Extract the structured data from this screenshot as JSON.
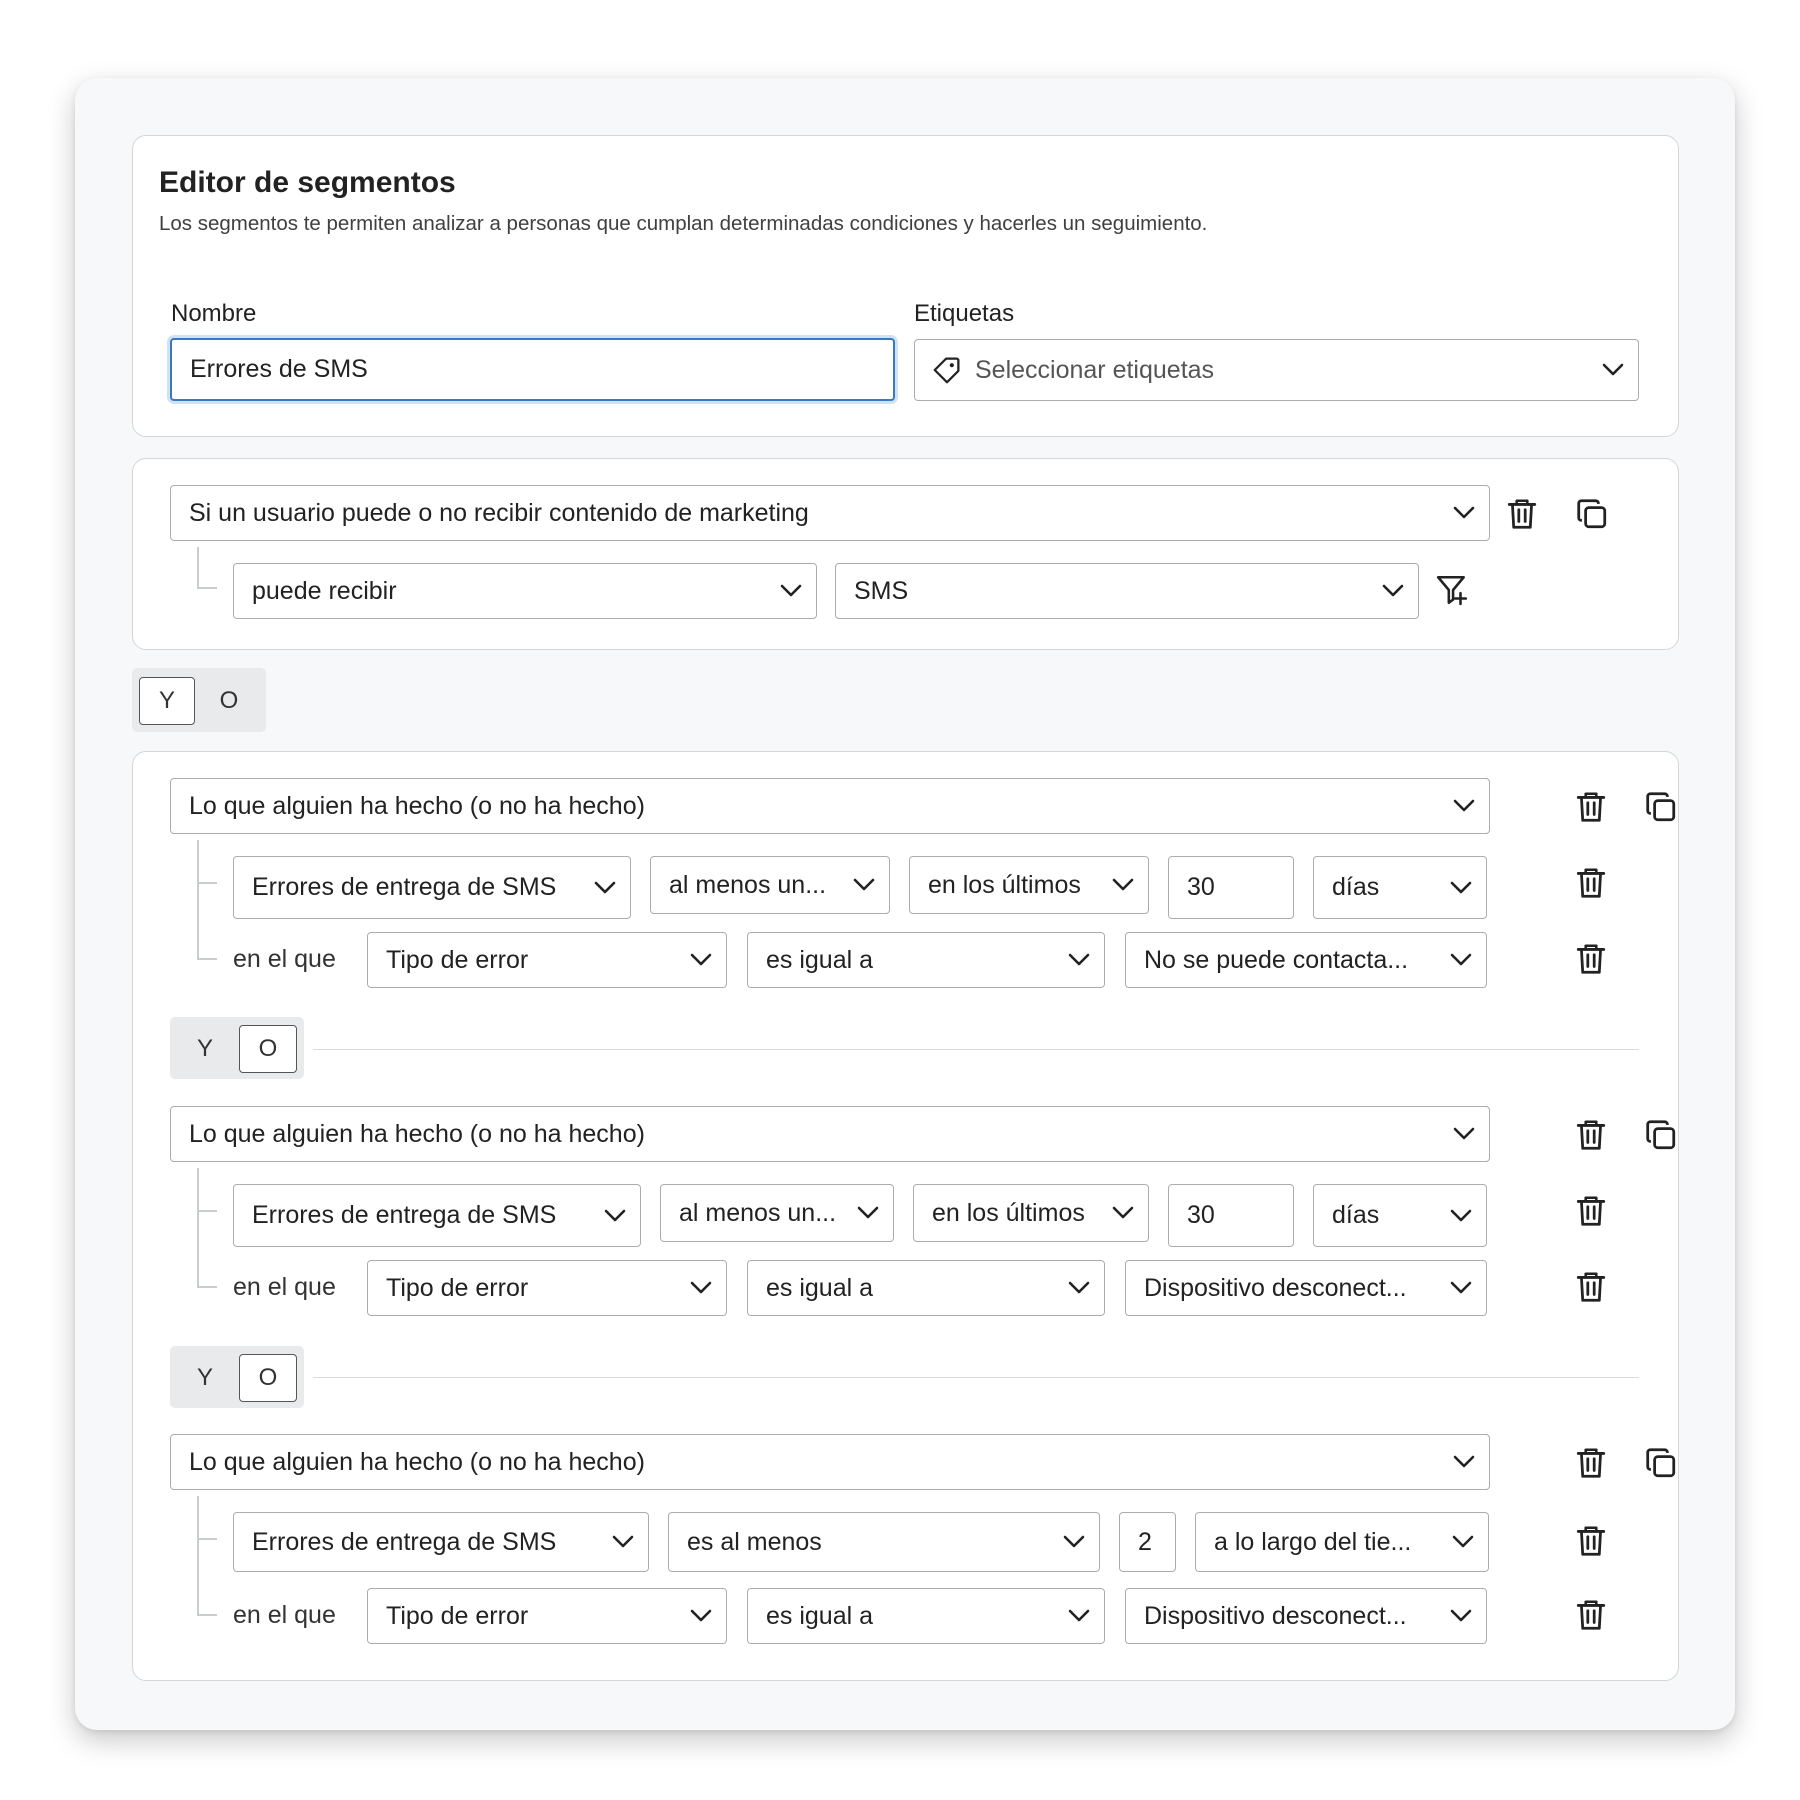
{
  "header": {
    "title": "Editor de segmentos",
    "description": "Los segmentos te permiten analizar a personas que cumplan determinadas condiciones y hacerles un seguimiento.",
    "name_label": "Nombre",
    "name_value": "Errores de SMS",
    "tags_label": "Etiquetas",
    "tags_placeholder": "Seleccionar etiquetas"
  },
  "group1": {
    "criterion": "Si un usuario puede o no recibir contenido de marketing",
    "permission": "puede recibir",
    "channel": "SMS"
  },
  "between_groups": {
    "and_label": "Y",
    "or_label": "O",
    "active": "Y"
  },
  "group2": {
    "filters": [
      {
        "criterion": "Lo que alguien ha hecho (o no ha hecho)",
        "event": "Errores de entrega de SMS",
        "frequency": "al menos un...",
        "timeframe": "en los últimos",
        "count": "30",
        "unit": "días",
        "where_label": "en el que",
        "property": "Tipo de error",
        "operator": "es igual a",
        "value": "No se puede contacta..."
      },
      {
        "criterion": "Lo que alguien ha hecho (o no ha hecho)",
        "event": "Errores de entrega de SMS",
        "frequency": "al menos un...",
        "timeframe": "en los últimos",
        "count": "30",
        "unit": "días",
        "where_label": "en el que",
        "property": "Tipo de error",
        "operator": "es igual a",
        "value": "Dispositivo desconect..."
      },
      {
        "criterion": "Lo que alguien ha hecho (o no ha hecho)",
        "event": "Errores de entrega de SMS",
        "frequency": "es al menos",
        "count": "2",
        "timeframe": "a lo largo del tie...",
        "where_label": "en el que",
        "property": "Tipo de error",
        "operator": "es igual a",
        "value": "Dispositivo desconect..."
      }
    ],
    "inner_toggle": {
      "and_label": "Y",
      "or_label": "O",
      "active": "O"
    }
  },
  "icons": [
    "tag-icon",
    "chevron-down-icon",
    "trash-icon",
    "copy-icon",
    "filter-add-icon"
  ]
}
